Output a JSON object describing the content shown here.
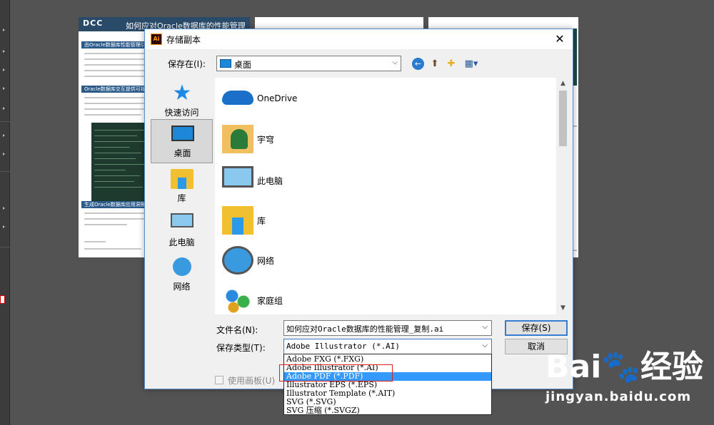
{
  "background_doc": {
    "artboard1": {
      "logo": "DCC",
      "title": "如何应对Oracle数据库的性能管理",
      "sections": [
        "由Oracle数据库性能管理引发的",
        "Oracle数据库交互提供可视化",
        "生成Oracle数据库应用洞察"
      ]
    }
  },
  "dialog": {
    "title": "存储副本",
    "close_glyph": "✕",
    "save_in": {
      "label": "保存在(I):",
      "value": "桌面"
    },
    "toolbar": {
      "back": "←",
      "up": "⬆",
      "new_folder": "✚",
      "view": "▦▾"
    },
    "places": [
      {
        "name": "quick-access",
        "label": "快速访问",
        "icon": "star-icon"
      },
      {
        "name": "desktop",
        "label": "桌面",
        "icon": "desktop-icon",
        "selected": true
      },
      {
        "name": "libraries",
        "label": "库",
        "icon": "library-icon"
      },
      {
        "name": "this-pc",
        "label": "此电脑",
        "icon": "pc-icon"
      },
      {
        "name": "network",
        "label": "网络",
        "icon": "network-icon"
      }
    ],
    "files": [
      {
        "label": "OneDrive",
        "icon": "onedrive-icon"
      },
      {
        "label": "宇穹",
        "icon": "user-folder-icon"
      },
      {
        "label": "此电脑",
        "icon": "pc-icon"
      },
      {
        "label": "库",
        "icon": "library-icon"
      },
      {
        "label": "网络",
        "icon": "network-icon"
      },
      {
        "label": "家庭组",
        "icon": "homegroup-icon"
      }
    ],
    "filename": {
      "label": "文件名(N):",
      "value": "如何应对Oracle数据库的性能管理_复制.ai"
    },
    "filetype": {
      "label": "保存类型(T):",
      "value": "Adobe Illustrator (*.AI)",
      "options": [
        "Adobe FXG (*.FXG)",
        "Adobe Illustrator (*.AI)",
        "Adobe PDF (*.PDF)",
        "Illustrator EPS (*.EPS)",
        "Illustrator Template (*.AIT)",
        "SVG (*.SVG)",
        "SVG 压缩 (*.SVGZ)"
      ],
      "highlighted_option": "Adobe PDF (*.PDF)"
    },
    "save_button": "保存(S)",
    "cancel_button": "取消",
    "use_artboards": "使用画板(U)"
  },
  "watermark": {
    "logo": "Bai🐾经验",
    "url": "jingyan.baidu.com"
  },
  "colors": {
    "selection": "#3399ff",
    "highlight_box": "#e02020",
    "dialog_border": "#5a8fc8"
  }
}
